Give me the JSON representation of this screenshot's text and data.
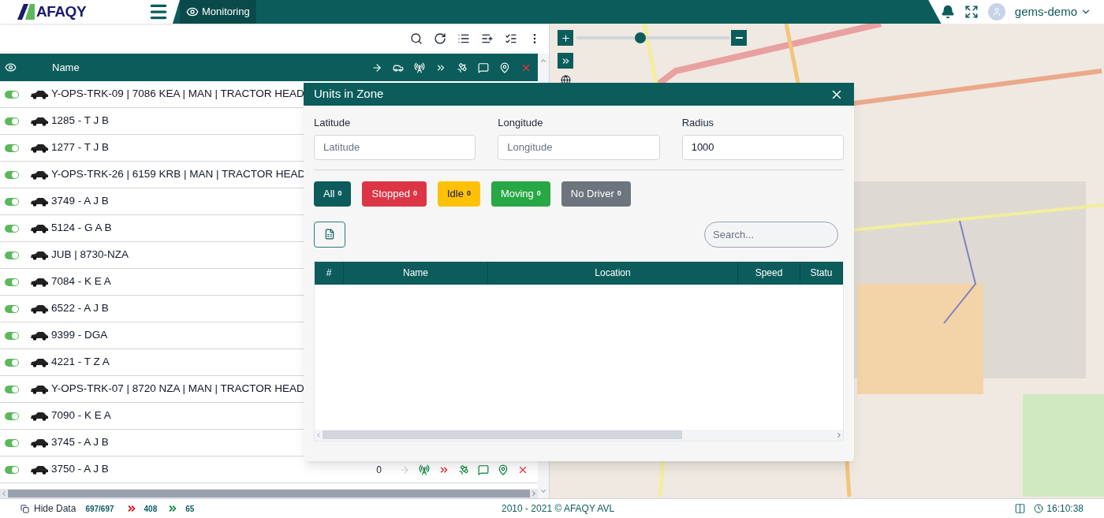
{
  "header": {
    "logo": "AFAQY",
    "tab": "Monitoring",
    "user": "gems-demo"
  },
  "map": {
    "zoom": {
      "level": 0.42
    }
  },
  "units_table": {
    "name_column": "Name",
    "rows": [
      {
        "name": "Y-OPS-TRK-09 | 7086 KEA | MAN | TRACTOR HEAD",
        "on": true
      },
      {
        "name": "1285 - T J B",
        "on": true
      },
      {
        "name": "1277 - T J B",
        "on": true
      },
      {
        "name": "Y-OPS-TRK-26 | 6159 KRB | MAN | TRACTOR HEAD",
        "on": true
      },
      {
        "name": "3749 - A J B",
        "on": true
      },
      {
        "name": "5124 - G A B",
        "on": true
      },
      {
        "name": "JUB | 8730-NZA",
        "on": true
      },
      {
        "name": "7084 - K E A",
        "on": true
      },
      {
        "name": "6522 - A J B",
        "on": true
      },
      {
        "name": "9399 - DGA",
        "on": true
      },
      {
        "name": "4221 - T Z A",
        "on": true
      },
      {
        "name": "Y-OPS-TRK-07 | 8720 NZA | MAN | TRACTOR HEAD",
        "on": true
      },
      {
        "name": "7090 - K E A",
        "on": true
      },
      {
        "name": "3745 - A J B",
        "on": true
      },
      {
        "name": "3750 - A J B",
        "on": true,
        "reading": "0"
      }
    ]
  },
  "dialog": {
    "title": "Units in Zone",
    "fields": [
      {
        "label": "Latitude",
        "placeholder": "Latitude"
      },
      {
        "label": "Longitude",
        "placeholder": "Longitude"
      },
      {
        "label": "Radius",
        "value": "1000"
      }
    ],
    "filters": [
      {
        "label": "All",
        "count": "0",
        "color": "#0d5c5c"
      },
      {
        "label": "Stopped",
        "count": "0",
        "color": "#dc3545"
      },
      {
        "label": "Idle",
        "count": "0",
        "color": "#ffc107"
      },
      {
        "label": "Moving",
        "count": "0",
        "color": "#28a745"
      },
      {
        "label": "No Driver",
        "count": "0",
        "color": "#6c757d"
      }
    ],
    "search": {
      "placeholder": "Search..."
    },
    "columns": [
      "#",
      "Name",
      "Location",
      "Speed",
      "Statu"
    ]
  },
  "status_bar": {
    "hide_data": "Hide Data",
    "total": "697/697",
    "stopped": "408",
    "moving": "65",
    "copyright": "2010 - 2021 © AFAQY AVL",
    "time": "16:10:38"
  }
}
